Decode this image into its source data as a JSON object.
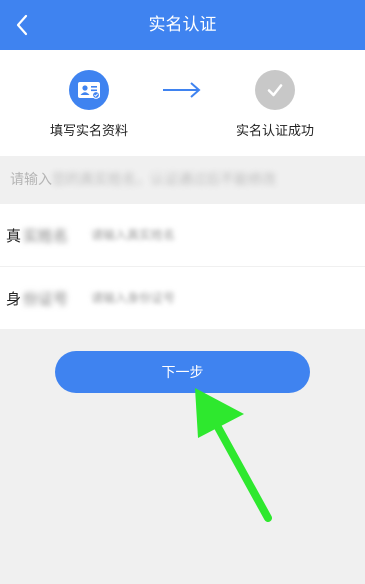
{
  "header": {
    "title": "实名认证",
    "back_icon": "chevron-left-icon"
  },
  "steps": [
    {
      "label": "填写实名资料",
      "icon": "id-card-icon",
      "state": "current",
      "color": "#3f83f0"
    },
    {
      "label": "实名认证成功",
      "icon": "check-icon",
      "state": "pending",
      "color": "#c8c8c8"
    }
  ],
  "steps_arrow_icon": "arrow-right-icon",
  "notice": {
    "prefix": "请输入",
    "rest": "您的真实姓名，认证通过后不能修改"
  },
  "form": {
    "name": {
      "label_first": "真",
      "label_rest": "实姓名",
      "placeholder": "请输入真实姓名"
    },
    "id_number": {
      "label_first": "身",
      "label_rest": "份证号",
      "placeholder": "请输入身份证号"
    }
  },
  "next_button": {
    "label": "下一步"
  },
  "annotation": {
    "icon": "green-pointer-arrow-icon",
    "color": "#2ee82e"
  },
  "colors": {
    "accent": "#3f83f0",
    "background": "#f0f0f0",
    "inactive_step": "#c8c8c8"
  }
}
